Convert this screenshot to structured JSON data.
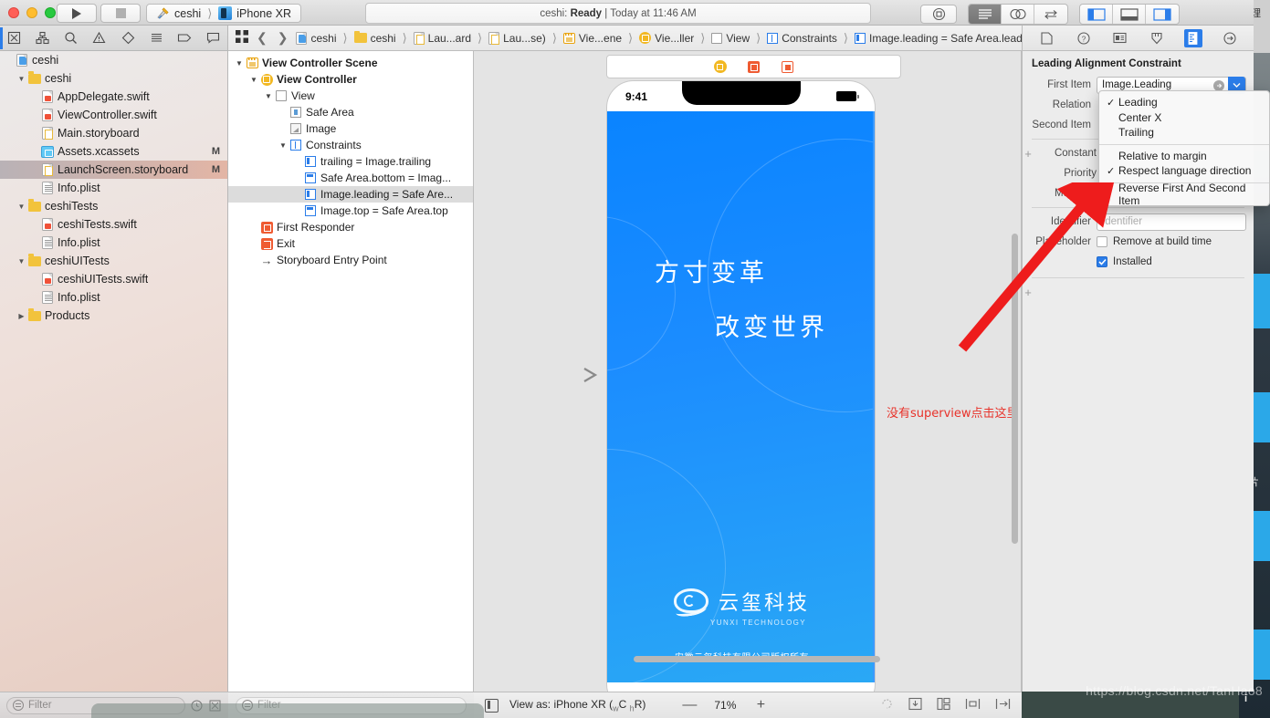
{
  "titlebar": {
    "scheme_project": "ceshi",
    "scheme_device": "iPhone XR",
    "status": "ceshi: Ready | Today at 11:46 AM",
    "status_app": "ceshi:",
    "status_state": "Ready",
    "status_time": "| Today at 11:46 AM",
    "run_icon": "play-icon",
    "stop_icon": "stop-icon"
  },
  "jumpbar": {
    "crumbs": [
      {
        "label": "ceshi",
        "icon": "project-icon"
      },
      {
        "label": "ceshi",
        "icon": "folder-icon"
      },
      {
        "label": "Lau...ard",
        "icon": "storyboard-icon"
      },
      {
        "label": "Lau...se)",
        "icon": "storyboard-icon"
      },
      {
        "label": "Vie...ene",
        "icon": "scene-icon"
      },
      {
        "label": "Vie...ller",
        "icon": "view-controller-icon"
      },
      {
        "label": "View",
        "icon": "view-icon"
      },
      {
        "label": "Constraints",
        "icon": "constraints-icon"
      },
      {
        "label": "Image.leading = Safe Area.leading",
        "icon": "constraint-icon"
      }
    ]
  },
  "navigator": {
    "items": [
      {
        "label": "ceshi",
        "indent": 0,
        "icon": "project-icon",
        "disc": "",
        "flag": ""
      },
      {
        "label": "ceshi",
        "indent": 1,
        "icon": "folder-icon",
        "disc": "down",
        "flag": ""
      },
      {
        "label": "AppDelegate.swift",
        "indent": 2,
        "icon": "swift-icon",
        "disc": "",
        "flag": ""
      },
      {
        "label": "ViewController.swift",
        "indent": 2,
        "icon": "swift-icon",
        "disc": "",
        "flag": ""
      },
      {
        "label": "Main.storyboard",
        "indent": 2,
        "icon": "storyboard-icon",
        "disc": "",
        "flag": ""
      },
      {
        "label": "Assets.xcassets",
        "indent": 2,
        "icon": "xcassets-icon",
        "disc": "",
        "flag": "M"
      },
      {
        "label": "LaunchScreen.storyboard",
        "indent": 2,
        "icon": "storyboard-icon",
        "disc": "",
        "flag": "M",
        "selected": true
      },
      {
        "label": "Info.plist",
        "indent": 2,
        "icon": "plist-icon",
        "disc": "",
        "flag": ""
      },
      {
        "label": "ceshiTests",
        "indent": 1,
        "icon": "folder-icon",
        "disc": "down",
        "flag": ""
      },
      {
        "label": "ceshiTests.swift",
        "indent": 2,
        "icon": "swift-icon",
        "disc": "",
        "flag": ""
      },
      {
        "label": "Info.plist",
        "indent": 2,
        "icon": "plist-icon",
        "disc": "",
        "flag": ""
      },
      {
        "label": "ceshiUITests",
        "indent": 1,
        "icon": "folder-icon",
        "disc": "down",
        "flag": ""
      },
      {
        "label": "ceshiUITests.swift",
        "indent": 2,
        "icon": "swift-icon",
        "disc": "",
        "flag": ""
      },
      {
        "label": "Info.plist",
        "indent": 2,
        "icon": "plist-icon",
        "disc": "",
        "flag": ""
      },
      {
        "label": "Products",
        "indent": 1,
        "icon": "folder-icon",
        "disc": "right",
        "flag": ""
      }
    ],
    "filter_placeholder": "Filter"
  },
  "outline": {
    "items": [
      {
        "label": "View Controller Scene",
        "indent": 0,
        "icon": "scene-icon",
        "disc": "down",
        "bold": true
      },
      {
        "label": "View Controller",
        "indent": 1,
        "icon": "view-controller-icon",
        "disc": "down",
        "bold": true
      },
      {
        "label": "View",
        "indent": 2,
        "icon": "view-icon",
        "disc": "down",
        "bold": false
      },
      {
        "label": "Safe Area",
        "indent": 3,
        "icon": "safe-area-icon",
        "disc": "",
        "bold": false
      },
      {
        "label": "Image",
        "indent": 3,
        "icon": "image-view-icon",
        "disc": "",
        "bold": false
      },
      {
        "label": "Constraints",
        "indent": 3,
        "icon": "constraints-icon",
        "disc": "down",
        "bold": false
      },
      {
        "label": "trailing = Image.trailing",
        "indent": 4,
        "icon": "constraint-icon",
        "disc": "",
        "bold": false
      },
      {
        "label": "Safe Area.bottom = Imag...",
        "indent": 4,
        "icon": "constraint-h-icon",
        "disc": "",
        "bold": false
      },
      {
        "label": "Image.leading = Safe Are...",
        "indent": 4,
        "icon": "constraint-icon",
        "disc": "",
        "bold": false,
        "selected": true
      },
      {
        "label": "Image.top = Safe Area.top",
        "indent": 4,
        "icon": "constraint-h-icon",
        "disc": "",
        "bold": false
      },
      {
        "label": "First Responder",
        "indent": 1,
        "icon": "first-responder-icon",
        "disc": "",
        "bold": false
      },
      {
        "label": "Exit",
        "indent": 1,
        "icon": "exit-icon",
        "disc": "",
        "bold": false
      },
      {
        "label": "Storyboard Entry Point",
        "indent": 1,
        "icon": "entry-point-icon",
        "disc": "",
        "bold": false
      }
    ],
    "filter_placeholder": "Filter"
  },
  "canvas": {
    "phone": {
      "time": "9:41",
      "splash_line1": "方寸变革",
      "splash_line2": "改变世界",
      "logo_cn": "云玺科技",
      "logo_en": "YUNXI TECHNOLOGY",
      "copyright": "安徽云玺科技有限公司版权所有",
      "background_color": "#0a84ff"
    },
    "annotation": "没有superview点击这里",
    "annotation_color": "#e8322a",
    "bottom_bar": {
      "view_as_label": "View as: iPhone XR (",
      "view_as_traits_w": "w",
      "view_as_traits_c": "C ",
      "view_as_traits_h": "h",
      "view_as_traits_r": "R)",
      "zoom_out": "—",
      "zoom_value": "71%",
      "zoom_in": "+"
    }
  },
  "inspector": {
    "title": "Leading Alignment Constraint",
    "rows": [
      {
        "label": "First Item",
        "value": "Image.Leading"
      },
      {
        "label": "Relation",
        "value": ""
      },
      {
        "label": "Second Item",
        "value": ""
      },
      {
        "label": "Constant",
        "value": ""
      },
      {
        "label": "Priority",
        "value": ""
      },
      {
        "label": "Multiplier",
        "value": ""
      },
      {
        "label": "Identifier",
        "value": ""
      },
      {
        "label": "Placeholder",
        "value": ""
      }
    ],
    "identifier_placeholder": "Identifier",
    "placeholder_checkbox": "Remove at build time",
    "installed_checkbox": "Installed",
    "first_item_label": "First Item",
    "relation_label": "Relation",
    "second_item_label": "Second Item",
    "constant_label": "Constant",
    "priority_label": "Priority",
    "multiplier_label": "Multiplier",
    "identifier_label": "Identifier",
    "placeholder_label": "Placeholder",
    "first_item_value": "Image.Leading"
  },
  "dropdown": {
    "groups": [
      {
        "items": [
          {
            "label": "Leading",
            "checked": true
          },
          {
            "label": "Center X",
            "checked": false
          },
          {
            "label": "Trailing",
            "checked": false
          }
        ]
      },
      {
        "items": [
          {
            "label": "Relative to margin",
            "checked": false
          },
          {
            "label": "Respect language direction",
            "checked": true
          }
        ]
      },
      {
        "items": [
          {
            "label": "Reverse First And Second Item",
            "checked": false
          }
        ]
      }
    ]
  },
  "watermark": "https://blog.csdn.net/TanHao8"
}
